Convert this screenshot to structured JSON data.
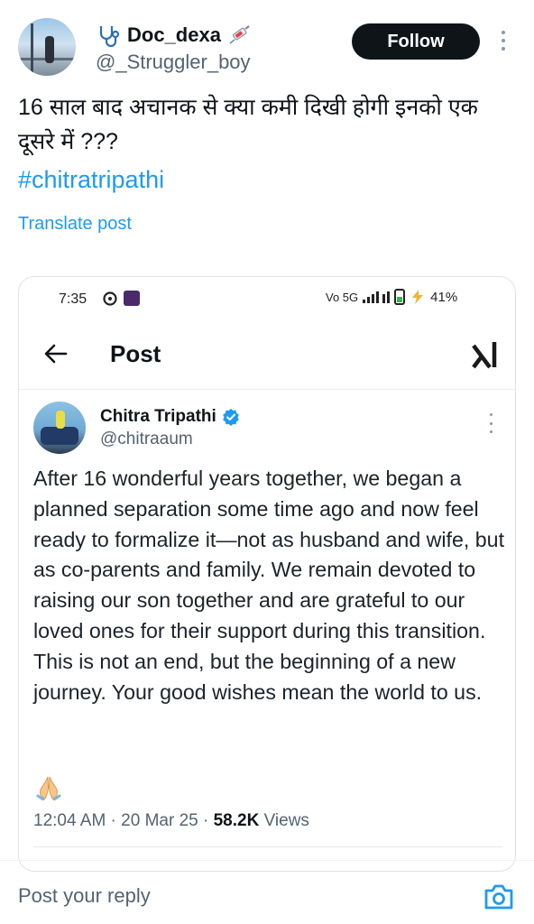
{
  "author": {
    "name": "Doc_dexa",
    "handle": "@_Struggler_boy",
    "name_icons": [
      "stethoscope-icon",
      "syringe-icon"
    ]
  },
  "follow_button": {
    "label": "Follow"
  },
  "post": {
    "text": "16 साल बाद अचानक से क्या कमी दिखी होगी इनको एक दूसरे में ???",
    "hashtag": "#chitratripathi",
    "translate_label": "Translate post"
  },
  "embedded_screenshot": {
    "status_bar": {
      "time": "7:35",
      "network": "Vo 5G",
      "battery": "41%"
    },
    "header": {
      "title": "Post",
      "back_icon": "arrow-left-icon",
      "logo": "xai-logo"
    },
    "tweet": {
      "name": "Chitra Tripathi",
      "handle": "@chitraaum",
      "verified": true,
      "text": "After 16 wonderful years together, we began a planned separation some time ago and now feel ready to formalize it—not as husband and wife, but as co-parents and family. We remain devoted to raising our son together and are grateful to our loved ones for their support during this transition. This is not an end, but the beginning of a new journey. Your good wishes mean the world to us.",
      "emoji": "folded-hands-icon",
      "timestamp": "12:04 AM · 20 Mar 25 · ",
      "views_count": "58.2K",
      "views_label": " Views"
    }
  },
  "reply": {
    "placeholder": "Post your reply",
    "camera_icon": "camera-icon"
  },
  "colors": {
    "accent": "#1d9bf0",
    "follow_bg": "#0f1419",
    "muted": "#536471",
    "verified": "#1d9bf0"
  }
}
